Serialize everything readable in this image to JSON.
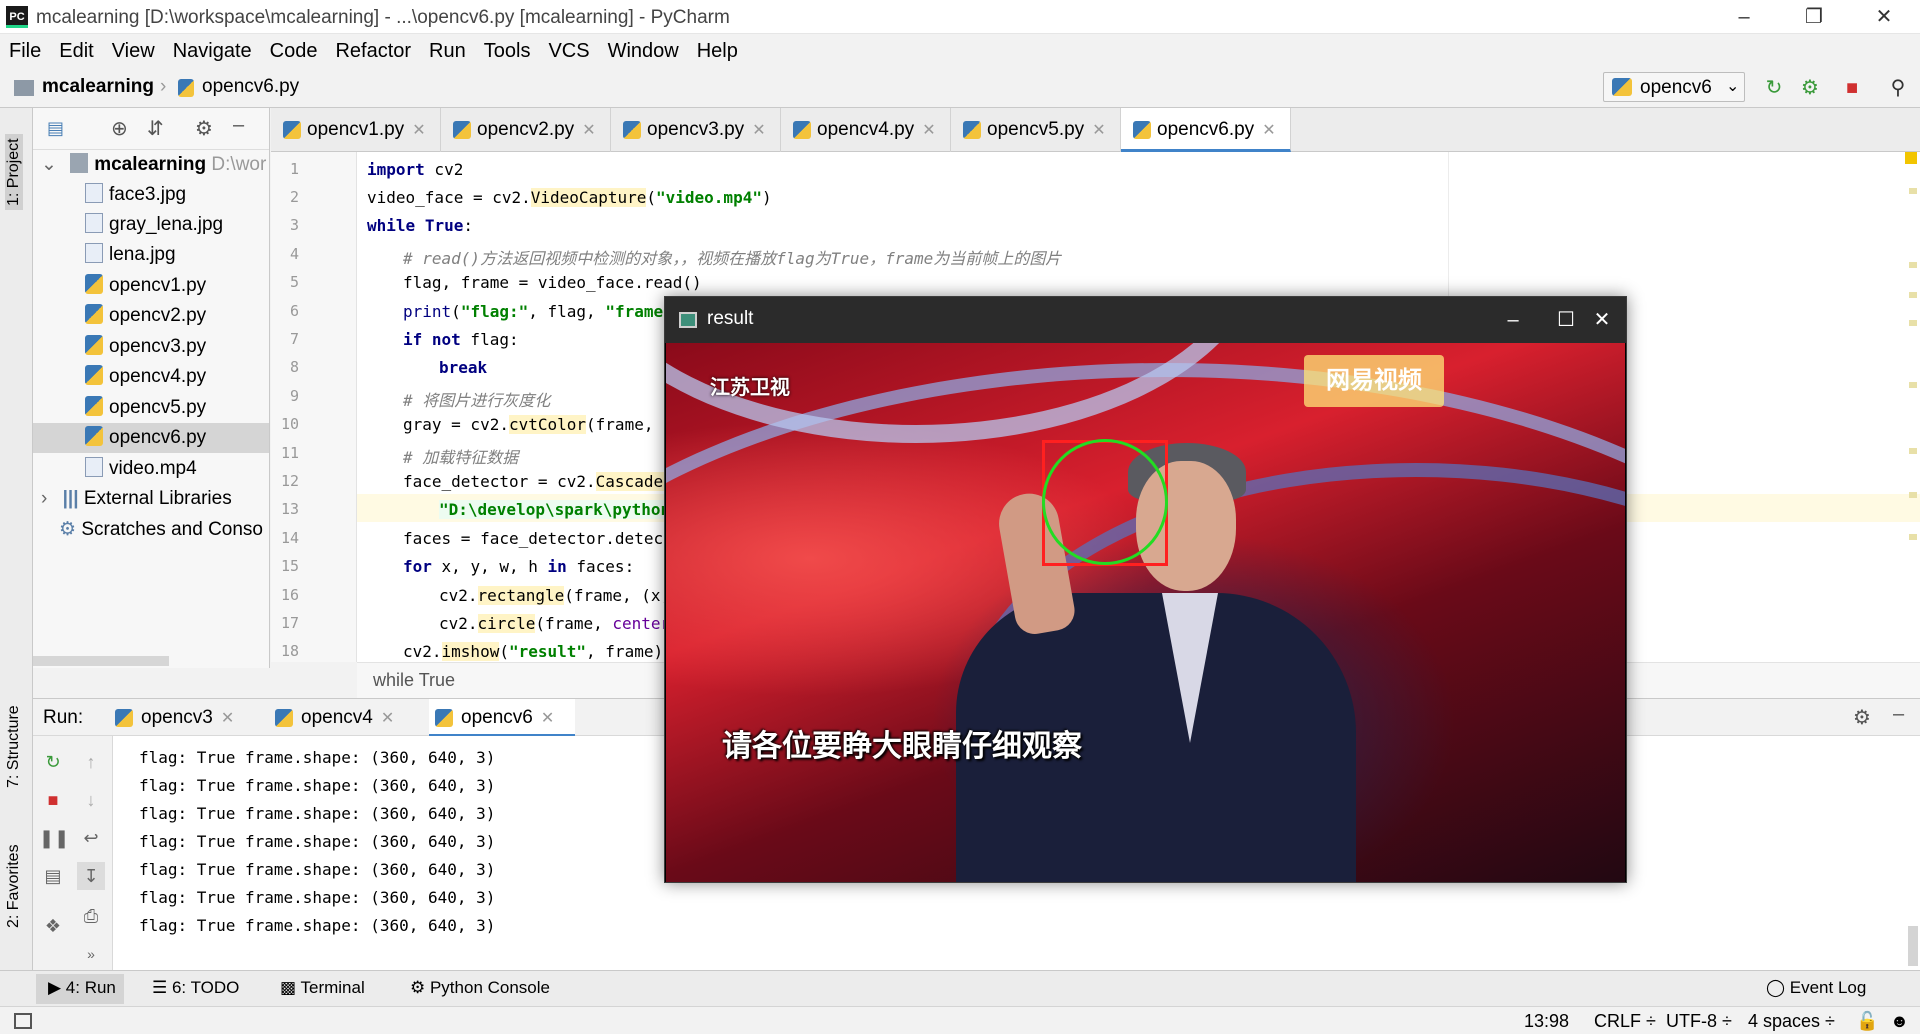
{
  "window": {
    "title": "mcalearning [D:\\workspace\\mcalearning] - ...\\opencv6.py [mcalearning] - PyCharm",
    "logo": "PC"
  },
  "menu": [
    "File",
    "Edit",
    "View",
    "Navigate",
    "Code",
    "Refactor",
    "Run",
    "Tools",
    "VCS",
    "Window",
    "Help"
  ],
  "nav": {
    "project": "mcalearning",
    "file": "opencv6.py",
    "run_config": "opencv6"
  },
  "left_stripe": {
    "project": "1: Project",
    "structure": "7: Structure",
    "favorites": "2: Favorites"
  },
  "project_tree": [
    {
      "label": "mcalearning",
      "hint": "D:\\wor",
      "type": "folder"
    },
    {
      "label": "face3.jpg",
      "type": "file"
    },
    {
      "label": "gray_lena.jpg",
      "type": "file"
    },
    {
      "label": "lena.jpg",
      "type": "file"
    },
    {
      "label": "opencv1.py",
      "type": "py"
    },
    {
      "label": "opencv2.py",
      "type": "py"
    },
    {
      "label": "opencv3.py",
      "type": "py"
    },
    {
      "label": "opencv4.py",
      "type": "py"
    },
    {
      "label": "opencv5.py",
      "type": "py"
    },
    {
      "label": "opencv6.py",
      "type": "py",
      "selected": true
    },
    {
      "label": "video.mp4",
      "type": "file"
    },
    {
      "label": "External Libraries",
      "type": "lib"
    },
    {
      "label": "Scratches and Conso",
      "type": "scratch"
    }
  ],
  "tabs": [
    "opencv1.py",
    "opencv2.py",
    "opencv3.py",
    "opencv4.py",
    "opencv5.py",
    "opencv6.py"
  ],
  "active_tab": "opencv6.py",
  "line_numbers": [
    "1",
    "2",
    "3",
    "4",
    "5",
    "6",
    "7",
    "8",
    "9",
    "10",
    "11",
    "12",
    "13",
    "14",
    "15",
    "16",
    "17",
    "18"
  ],
  "code": {
    "l1": [
      "import",
      " cv2"
    ],
    "l2": [
      "video_face = cv2.",
      "VideoCapture",
      "(",
      "\"video.mp4\"",
      ")"
    ],
    "l3": [
      "while",
      " ",
      "True",
      ":"
    ],
    "l4": "# read()方法返回视频中检测的对象，，视频在播放flag为True，frame为当前帧上的图片",
    "l5": "flag, frame = video_face.read()",
    "l6": [
      "print",
      "(",
      "\"flag:\"",
      ", flag, ",
      "\"frame.s"
    ],
    "l7": [
      "if not",
      " flag:"
    ],
    "l8": "break",
    "l9": "# 将图片进行灰度化",
    "l10": [
      "gray = cv2.",
      "cvtColor",
      "(frame, cv"
    ],
    "l11": "# 加载特征数据",
    "l12": [
      "face_detector = cv2.",
      "CascadeCl"
    ],
    "l13": "\"D:\\develop\\spark\\python\\",
    "l14": "faces = face_detector.detectM",
    "l15": [
      "for",
      " x, y, w, h ",
      "in",
      " faces:"
    ],
    "l16": [
      "cv2.",
      "rectangle",
      "(frame, (x,"
    ],
    "l17": [
      "cv2.",
      "circle",
      "(frame, ",
      "center="
    ],
    "l18": [
      "cv2.",
      "imshow",
      "(",
      "\"result\"",
      ", frame)"
    ]
  },
  "breadcrumb_status": "while True",
  "run_panel": {
    "label": "Run:",
    "tabs": [
      "opencv3",
      "opencv4",
      "opencv6"
    ],
    "active": "opencv6",
    "output": [
      "flag: True frame.shape: (360, 640, 3)",
      "flag: True frame.shape: (360, 640, 3)",
      "flag: True frame.shape: (360, 640, 3)",
      "flag: True frame.shape: (360, 640, 3)",
      "flag: True frame.shape: (360, 640, 3)",
      "flag: True frame.shape: (360, 640, 3)",
      "flag: True frame.shape: (360, 640, 3)"
    ]
  },
  "bottom_tools": {
    "run": "4: Run",
    "todo": "6: TODO",
    "terminal": "Terminal",
    "python_console": "Python Console",
    "event_log": "Event Log"
  },
  "status_bar": {
    "position": "13:98",
    "line_sep": "CRLF ÷",
    "encoding": "UTF-8 ÷",
    "indent": "4 spaces ÷"
  },
  "result_window": {
    "title": "result",
    "logo_left": "江苏卫视",
    "logo_right": "网易视频",
    "subtitle": "请各位要睁大眼睛仔细观察"
  },
  "colors": {
    "accent": "#4083c9",
    "face_box": "#ff2020",
    "face_circle": "#22dd22"
  }
}
